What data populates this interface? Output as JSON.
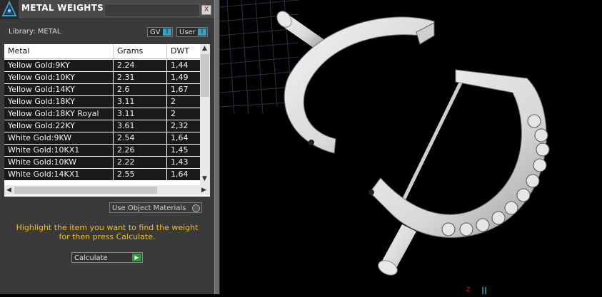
{
  "panel": {
    "title": "METAL WEIGHTS",
    "close_label": "X",
    "library_label": "Library: METAL",
    "toggles": [
      {
        "label": "GV",
        "indicator": "I"
      },
      {
        "label": "User",
        "indicator": "I"
      }
    ],
    "table": {
      "columns": [
        "Metal",
        "Grams",
        "DWT"
      ],
      "rows": [
        [
          "Yellow Gold:9KY",
          "2.24",
          "1,44"
        ],
        [
          "Yellow Gold:10KY",
          "2.31",
          "1,49"
        ],
        [
          "Yellow Gold:14KY",
          "2.6",
          "1,67"
        ],
        [
          "Yellow Gold:18KY",
          "3.11",
          "2"
        ],
        [
          "Yellow Gold:18KY Royal",
          "3.11",
          "2"
        ],
        [
          "Yellow Gold:22KY",
          "3.61",
          "2,32"
        ],
        [
          "White Gold:9KW",
          "2.54",
          "1,64"
        ],
        [
          "White Gold:10KX1",
          "2.26",
          "1,45"
        ],
        [
          "White Gold:10KW",
          "2.22",
          "1,43"
        ],
        [
          "White Gold:14KX1",
          "2.55",
          "1,64"
        ]
      ]
    },
    "use_object_materials": "Use Object Materials",
    "help_line1": "Highlight the item you want to find the weight",
    "help_line2": "for then press Calculate.",
    "calculate_label": "Calculate"
  },
  "colors": {
    "panel_bg": "#3a3a3a",
    "row_bg": "#1a1a1a",
    "help_text": "#f0c020",
    "accent_toggle": "#3aa0c0",
    "calculate_play": "#2a9a3a"
  },
  "viewport": {
    "axis_label": "Z",
    "model": "ring-with-pave-settings"
  }
}
